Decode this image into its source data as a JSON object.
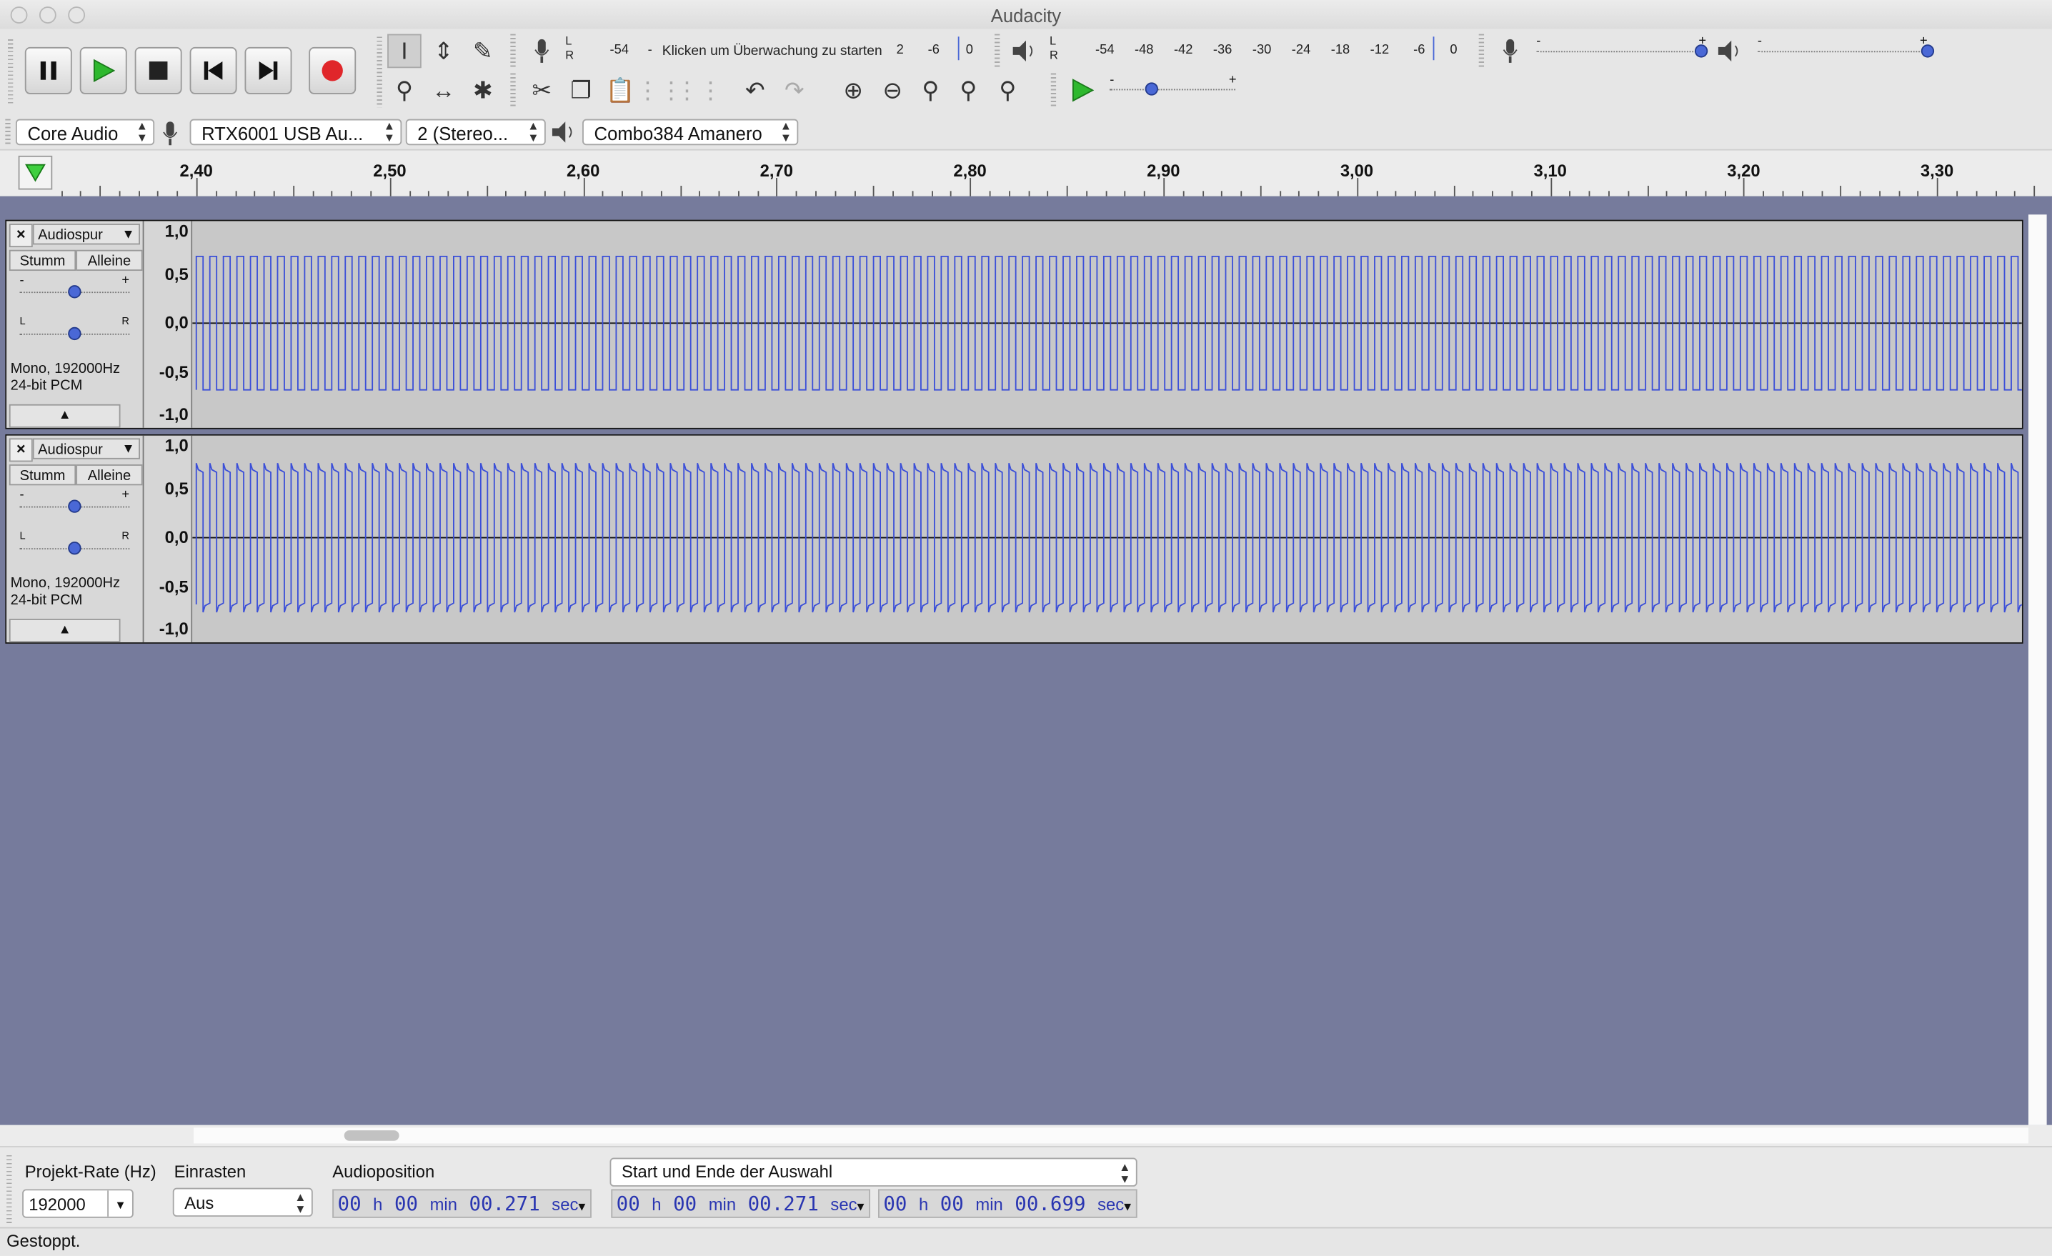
{
  "window": {
    "title": "Audacity"
  },
  "transport": {
    "pause": "pause-icon",
    "play": "play-icon",
    "stop": "stop-icon",
    "skip_start": "skip-start-icon",
    "skip_end": "skip-end-icon",
    "record": "record-icon",
    "record_color": "#e0262a",
    "play_color": "#2eb82e"
  },
  "rec_meter": {
    "lr": "L\nR",
    "ticks": [
      "-54",
      "-",
      "2",
      "-6",
      "0"
    ],
    "hint": "Klicken um Überwachung zu starten"
  },
  "play_meter": {
    "lr": "L\nR",
    "ticks": [
      "-54",
      "-48",
      "-42",
      "-36",
      "-30",
      "-24",
      "-18",
      "-12",
      "-6",
      "0"
    ]
  },
  "mixer": {
    "rec_minus": "-",
    "rec_plus": "+",
    "rec_level": 0.97,
    "play_minus": "-",
    "play_plus": "+",
    "play_level": 1.0
  },
  "play_at_speed": {
    "minus": "-",
    "plus": "+",
    "level": 0.33
  },
  "devices": {
    "host": "Core Audio",
    "rec_device": "RTX6001 USB Au...",
    "channels": "2 (Stereo...",
    "play_device": "Combo384 Amanero"
  },
  "ruler": {
    "labels": [
      "2,40",
      "2,50",
      "2,60",
      "2,70",
      "2,80",
      "2,90",
      "3,00",
      "3,10",
      "3,20",
      "3,30"
    ]
  },
  "tracks": [
    {
      "name": "Audiospur",
      "mute": "Stumm",
      "solo": "Alleine",
      "gain_minus": "-",
      "gain_plus": "+",
      "pan_l": "L",
      "pan_r": "R",
      "gain": 0.5,
      "pan": 0.5,
      "info1": "Mono, 192000Hz",
      "info2": "24-bit PCM",
      "scale": [
        "1,0",
        "0,5",
        "0,0",
        "-0,5",
        "-1,0"
      ]
    },
    {
      "name": "Audiospur",
      "mute": "Stumm",
      "solo": "Alleine",
      "gain_minus": "-",
      "gain_plus": "+",
      "pan_l": "L",
      "pan_r": "R",
      "gain": 0.5,
      "pan": 0.5,
      "info1": "Mono, 192000Hz",
      "info2": "24-bit PCM",
      "scale": [
        "1,0",
        "0,5",
        "0,0",
        "-0,5",
        "-1,0"
      ]
    }
  ],
  "waveform_color": "#3b4fd8",
  "bottom": {
    "rate_label": "Projekt-Rate (Hz)",
    "rate_value": "192000",
    "snap_label": "Einrasten",
    "snap_value": "Aus",
    "pos_label": "Audioposition",
    "pos": {
      "h": "00",
      "m": "00",
      "s": "00.271"
    },
    "sel_mode": "Start und Ende der Auswahl",
    "sel_start": {
      "h": "00",
      "m": "00",
      "s": "00.271"
    },
    "sel_end": {
      "h": "00",
      "m": "00",
      "s": "00.699"
    },
    "units": {
      "h": "h",
      "min": "min",
      "sec": "sec"
    }
  },
  "status": {
    "text": "Gestoppt."
  }
}
